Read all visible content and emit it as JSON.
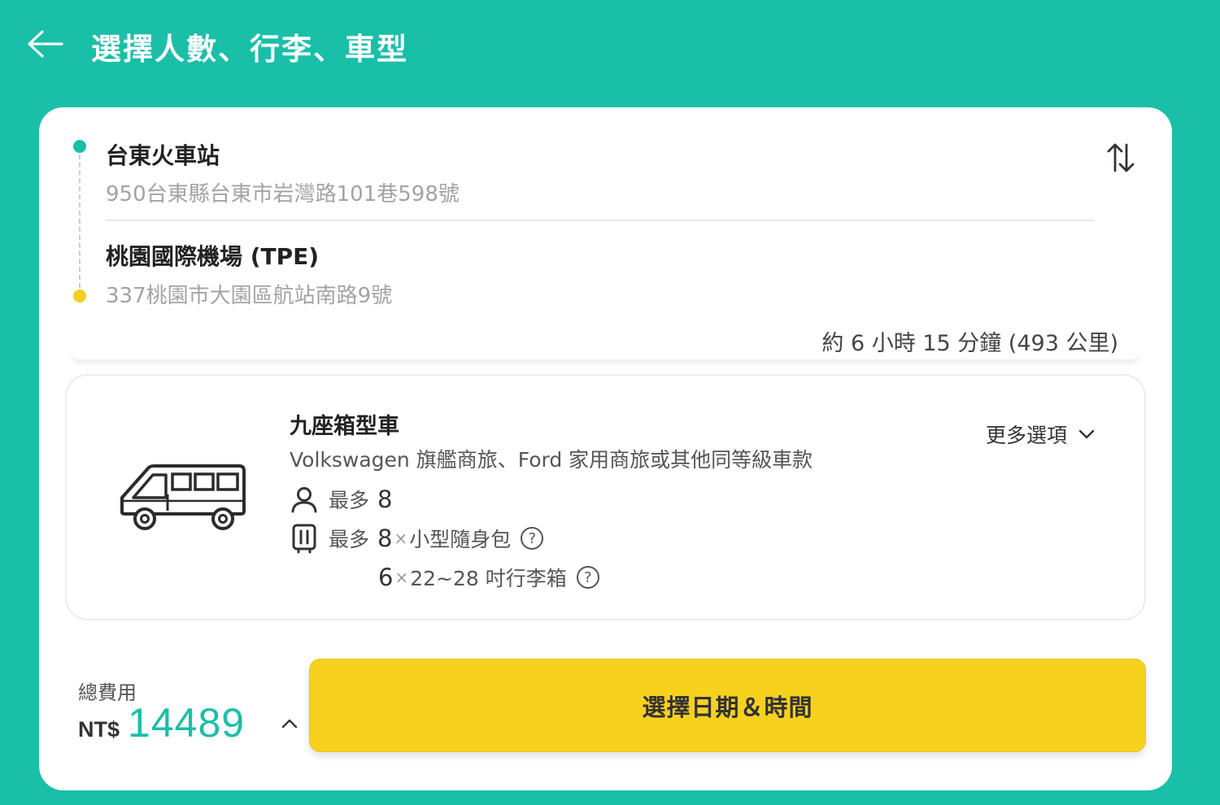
{
  "header": {
    "title": "選擇人數、行李、車型"
  },
  "route": {
    "origin": {
      "name": "台東火車站",
      "address": "950台東縣台東市岩灣路101巷598號"
    },
    "destination": {
      "name": "桃園國際機場 (TPE)",
      "address": "337桃園市大園區航站南路9號"
    },
    "trip_info": "約 6 小時 15 分鐘 (493 公里)"
  },
  "vehicle": {
    "name": "九座箱型車",
    "models": "Volkswagen 旗艦商旅、Ford 家用商旅或其他同等級車款",
    "more_options_label": "更多選項",
    "passengers": {
      "label": "最多",
      "count": "8"
    },
    "luggage": {
      "label": "最多",
      "small_count": "8",
      "small_text": "小型隨身包",
      "large_count": "6",
      "large_text": "22~28 吋行李箱",
      "times": "×",
      "help": "?"
    }
  },
  "footer": {
    "total_label": "總費用",
    "currency": "NT$",
    "price": "14489",
    "cta_label": "選擇日期＆時間"
  },
  "colors": {
    "brand_teal": "#1abfa8",
    "accent_yellow": "#f6d21f",
    "destination_dot": "#f5cf1f"
  }
}
